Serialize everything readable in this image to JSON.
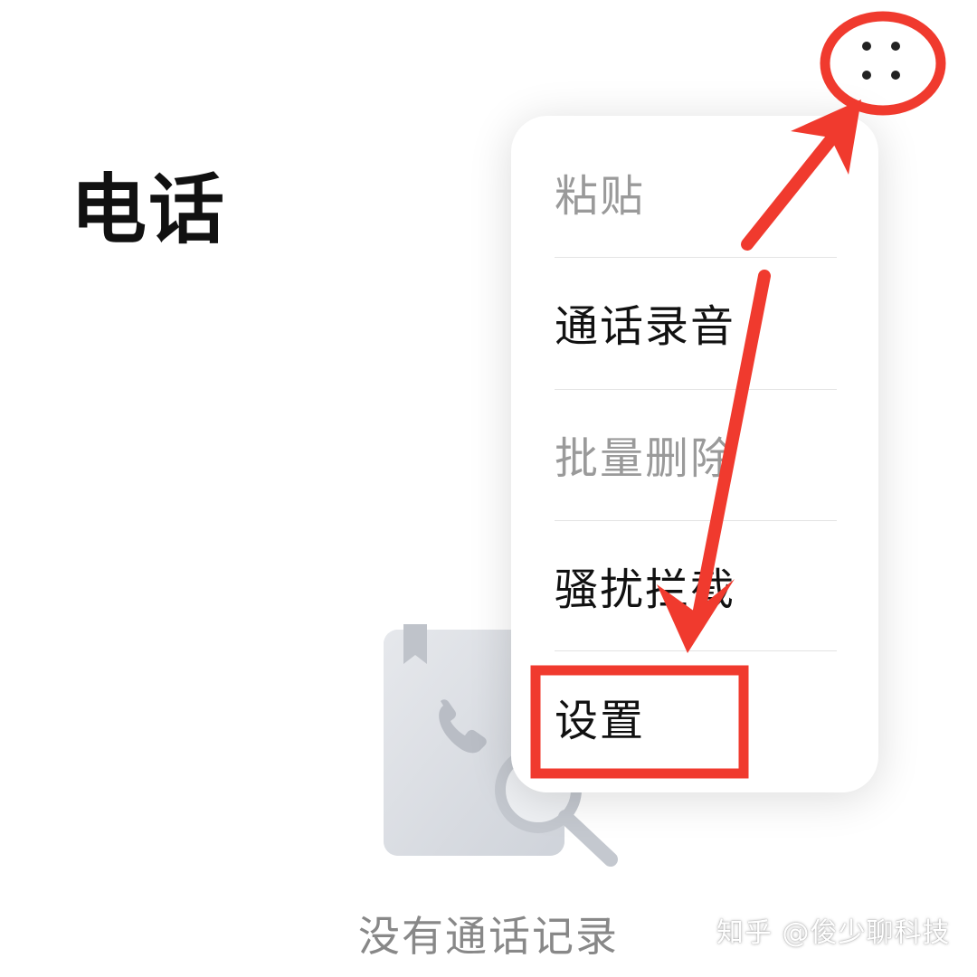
{
  "page": {
    "title": "电话",
    "empty_state_text": "没有通话记录"
  },
  "header": {
    "more_icon": "more-dots-icon"
  },
  "menu": {
    "items": [
      {
        "label": "粘贴",
        "enabled": false
      },
      {
        "label": "通话录音",
        "enabled": true
      },
      {
        "label": "批量删除",
        "enabled": false
      },
      {
        "label": "骚扰拦截",
        "enabled": true
      },
      {
        "label": "设置",
        "enabled": true
      }
    ]
  },
  "illustration": {
    "icon": "empty-call-log-illustration"
  },
  "watermark": {
    "text": "知乎 @俊少聊科技"
  },
  "annotations": {
    "color": "#f03a2e"
  },
  "colors": {
    "background": "#ffffff",
    "title_text": "#111111",
    "disabled_text": "#9a9a9a",
    "muted_text": "#888888"
  }
}
